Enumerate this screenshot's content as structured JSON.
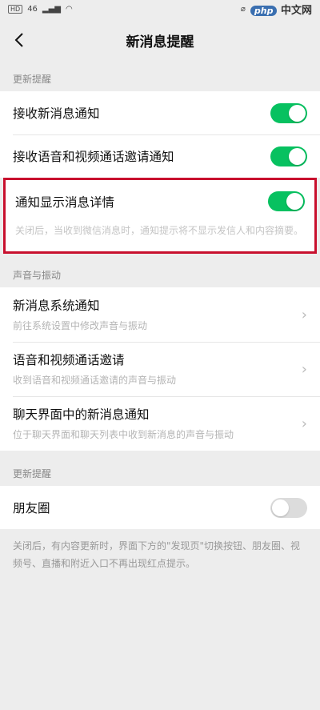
{
  "status_bar": {
    "sim": "HD",
    "signal": "46",
    "brand_php": "php",
    "brand_text": "中文网"
  },
  "nav": {
    "title": "新消息提醒"
  },
  "sections": {
    "s1_header": "更新提醒",
    "s2_header": "声音与振动",
    "s3_header": "更新提醒"
  },
  "rows": {
    "receive_new": {
      "label": "接收新消息通知",
      "on": true
    },
    "receive_call": {
      "label": "接收语音和视频通话邀请通知",
      "on": true
    },
    "show_detail": {
      "label": "通知显示消息详情",
      "on": true,
      "desc": "关闭后，当收到微信消息时，通知提示将不显示发信人和内容摘要。"
    },
    "system_notice": {
      "label": "新消息系统通知",
      "sub": "前往系统设置中修改声音与振动"
    },
    "call_invite": {
      "label": "语音和视频通话邀请",
      "sub": "收到语音和视频通话邀请的声音与振动"
    },
    "chat_notice": {
      "label": "聊天界面中的新消息通知",
      "sub": "位于聊天界面和聊天列表中收到新消息的声音与振动"
    },
    "moments": {
      "label": "朋友圈",
      "on": false
    }
  },
  "footer": "关闭后，有内容更新时，界面下方的\"发现页\"切换按钮、朋友圈、视频号、直播和附近入口不再出现红点提示。",
  "colors": {
    "accent": "#07c160",
    "highlight": "#c8102e"
  }
}
